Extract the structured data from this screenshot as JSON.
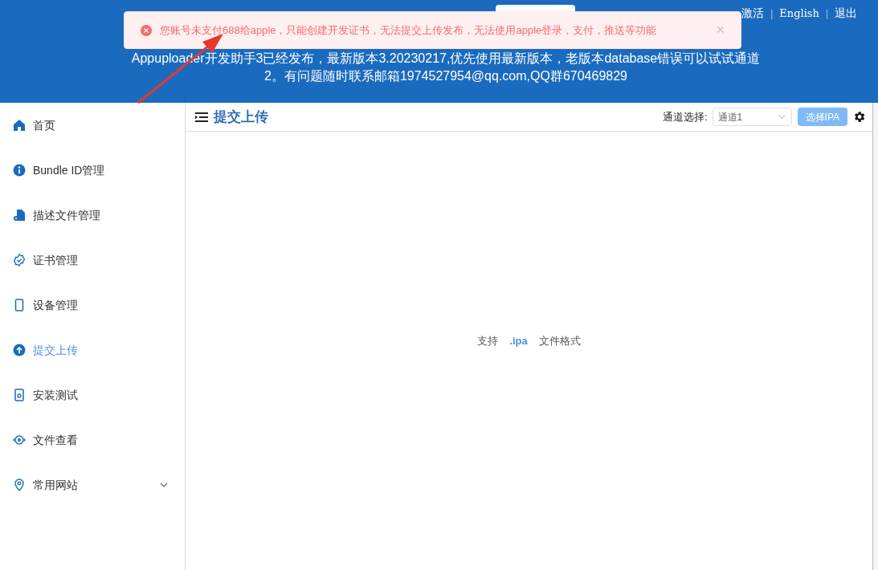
{
  "header": {
    "links": [
      "激活",
      "English",
      "退出"
    ],
    "separators": [
      "|",
      "|"
    ],
    "notice": [
      "Appuploader开发助手3已经发布，最新版本3.20230217,优先使用最新版本，老版本database错误可以试试通道",
      "2。有问题随时联系邮箱1974527954@qq.com,QQ群670469829"
    ]
  },
  "toast": {
    "message": "您账号未支付688给apple，只能创建开发证书，无法提交上传发布，无法使用apple登录，支付，推送等功能",
    "close": "×"
  },
  "sidebar": {
    "items": [
      {
        "label": "首页",
        "selected": false
      },
      {
        "label": "Bundle ID管理",
        "selected": false
      },
      {
        "label": "描述文件管理",
        "selected": false
      },
      {
        "label": "证书管理",
        "selected": false
      },
      {
        "label": "设备管理",
        "selected": false
      },
      {
        "label": "提交上传",
        "selected": true
      },
      {
        "label": "安装测试",
        "selected": false
      },
      {
        "label": "文件查看",
        "selected": false
      },
      {
        "label": "常用网站",
        "selected": false,
        "expandable": true
      }
    ]
  },
  "page": {
    "title": "提交上传",
    "channel_label": "通道选择:",
    "channel_value": "通道1",
    "choose_button": "选择IPA",
    "hint": [
      "支持",
      ".ipa",
      "文件格式"
    ]
  }
}
